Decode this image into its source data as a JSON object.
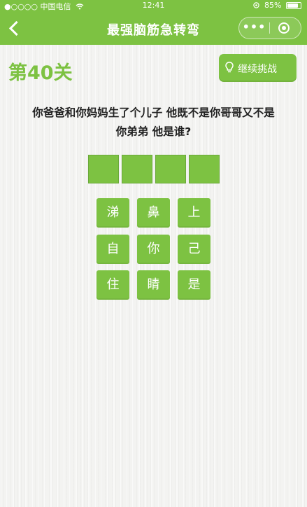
{
  "status_bar": {
    "carrier": "●○○○○ 中国电信",
    "time": "12:41",
    "battery_percent": "85%",
    "battery_level": 0.85
  },
  "nav": {
    "title": "最强脑筋急转弯",
    "more_label": "•••"
  },
  "level": "第40关",
  "continue_button": "继续挑战",
  "question": {
    "line1": "你爸爸和你妈妈生了个儿子 他既不是你哥哥又不是",
    "line2": "你弟弟 他是谁?"
  },
  "answer_slots": [
    "",
    "",
    "",
    ""
  ],
  "characters": [
    "涕",
    "鼻",
    "上",
    "自",
    "你",
    "己",
    "住",
    "睛",
    "是"
  ],
  "colors": {
    "accent": "#7dc242",
    "level_text": "#7dc242",
    "question_text": "#222222"
  },
  "icons": {
    "back": "chevron-left-icon",
    "bulb": "lightbulb-icon",
    "target": "target-icon",
    "wifi": "wifi-icon",
    "location": "location-icon"
  }
}
